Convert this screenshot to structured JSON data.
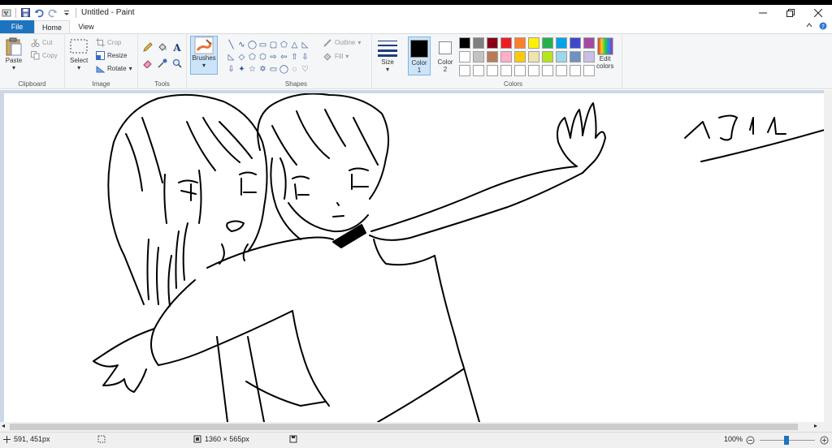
{
  "window": {
    "title": "Untitled - Paint"
  },
  "tabs": {
    "file": "File",
    "home": "Home",
    "view": "View"
  },
  "clipboard": {
    "paste": "Paste",
    "cut": "Cut",
    "copy": "Copy",
    "group": "Clipboard"
  },
  "image": {
    "select": "Select",
    "crop": "Crop",
    "resize": "Resize",
    "rotate": "Rotate",
    "group": "Image"
  },
  "tools": {
    "group": "Tools"
  },
  "brushes": {
    "label": "Brushes"
  },
  "shapes": {
    "outline": "Outline",
    "fill": "Fill",
    "group": "Shapes"
  },
  "size": {
    "label": "Size"
  },
  "colors": {
    "color1_label": "Color",
    "color1_num": "1",
    "color2_label": "Color",
    "color2_num": "2",
    "edit_label": "Edit",
    "edit_label2": "colors",
    "group": "Colors",
    "color1": "#000000",
    "color2": "#ffffff",
    "palette_row1": [
      "#000000",
      "#7f7f7f",
      "#880015",
      "#ed1c24",
      "#ff7f27",
      "#fff200",
      "#22b14c",
      "#00a2e8",
      "#3f48cc",
      "#a349a4"
    ],
    "palette_row2": [
      "#ffffff",
      "#c3c3c3",
      "#b97a57",
      "#ffaec9",
      "#ffc90e",
      "#efe4b0",
      "#b5e61d",
      "#99d9ea",
      "#7092be",
      "#c8bfe7"
    ],
    "palette_row3": [
      "#ffffff",
      "#ffffff",
      "#ffffff",
      "#ffffff",
      "#ffffff",
      "#ffffff",
      "#ffffff",
      "#ffffff",
      "#ffffff",
      "#ffffff"
    ]
  },
  "canvas": {
    "text": "1911"
  },
  "status": {
    "cursor_pos": "591, 451px",
    "canvas_size": "1360 × 565px",
    "zoom": "100%"
  }
}
